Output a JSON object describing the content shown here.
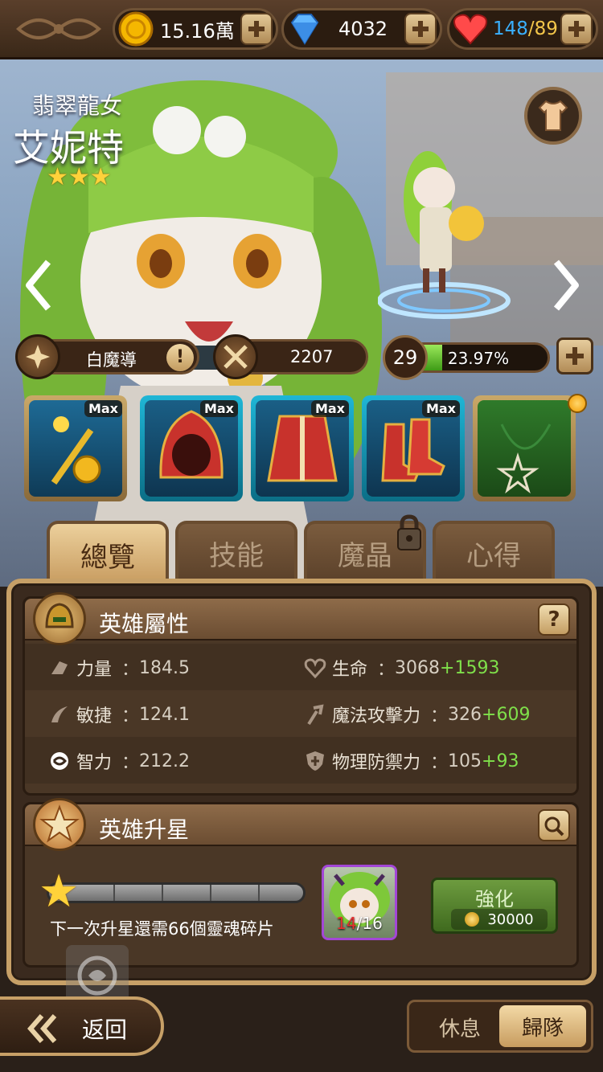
{
  "resources": {
    "gold": "15.16萬",
    "gems": "4032",
    "stamina_current": "148",
    "stamina_sep": "/",
    "stamina_max": "89"
  },
  "hero": {
    "title": "翡翠龍女",
    "name": "艾妮特",
    "stars": 3,
    "star_glyph": "★★★"
  },
  "info": {
    "class_name": "白魔導",
    "info_symbol": "!",
    "power": "2207",
    "level": "29",
    "exp_percent_text": "23.97%",
    "exp_fraction": 0.2397
  },
  "equipment": [
    {
      "name": "staff",
      "badge": "Max"
    },
    {
      "name": "hood",
      "badge": "Max"
    },
    {
      "name": "robe",
      "badge": "Max"
    },
    {
      "name": "boots",
      "badge": "Max"
    },
    {
      "name": "necklace",
      "badge": ""
    }
  ],
  "tabs": [
    {
      "label": "總覽",
      "active": true
    },
    {
      "label": "技能",
      "active": false
    },
    {
      "label": "魔晶",
      "active": false,
      "locked": true
    },
    {
      "label": "心得",
      "active": false
    }
  ],
  "attributes_section": {
    "title": "英雄屬性",
    "help": "?",
    "rows": [
      {
        "left": {
          "label": "力量",
          "sep": "：",
          "value": "184.5"
        },
        "right": {
          "label": "生命",
          "sep": "：",
          "value": "3068",
          "bonus": "+1593"
        }
      },
      {
        "left": {
          "label": "敏捷",
          "sep": "：",
          "value": "124.1"
        },
        "right": {
          "label": "魔法攻擊力",
          "sep": "：",
          "value": "326",
          "bonus": "+609"
        }
      },
      {
        "left": {
          "label": "智力",
          "sep": "：",
          "value": "212.2"
        },
        "right": {
          "label": "物理防禦力",
          "sep": "：",
          "value": "105",
          "bonus": "+93"
        }
      }
    ]
  },
  "star_section": {
    "title": "英雄升星",
    "note": "下一次升星還需66個靈魂碎片",
    "soul_have": "14",
    "soul_need": "/16",
    "enhance_label": "強化",
    "enhance_cost": "30000",
    "progress_fraction": 0
  },
  "bottom": {
    "back_label": "返回",
    "rest_label": "休息",
    "team_label": "歸隊"
  },
  "colors": {
    "accent_gold": "#c7a067",
    "bonus_green": "#7fe04a",
    "stamina_blue": "#3ab0ff",
    "stamina_gold": "#f3c64a"
  }
}
